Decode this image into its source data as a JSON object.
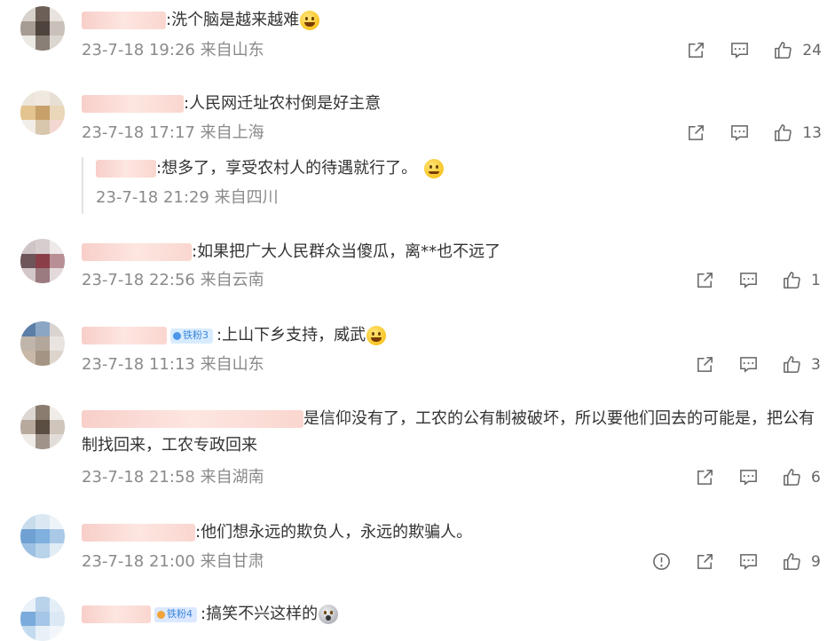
{
  "comments": [
    {
      "text": "洗个脑是越来越难",
      "time": "23-7-18 19:26",
      "location": "来自山东",
      "likes": "24",
      "emoji": "grin"
    },
    {
      "text": "人民网迁址农村倒是好主意",
      "time": "23-7-18 17:17",
      "location": "来自上海",
      "likes": "13",
      "reply": {
        "text": "想多了，享受农村人的待遇就行了。",
        "time": "23-7-18 21:29",
        "location": "来自四川",
        "emoji": "smile"
      }
    },
    {
      "text": "如果把广大人民群众当傻瓜，离**也不远了",
      "time": "23-7-18 22:56",
      "location": "来自云南",
      "likes": "1"
    },
    {
      "text": "上山下乡支持，威武",
      "time": "23-7-18 11:13",
      "location": "来自山东",
      "likes": "3",
      "badge": "铁粉3",
      "emoji": "cheer"
    },
    {
      "text": "是信仰没有了，工农的公有制被破坏，所以要他们回去的可能是，把公有制找回来，工农专政回来",
      "time": "23-7-18 21:58",
      "location": "来自湖南",
      "likes": "6"
    },
    {
      "text": "他们想永远的欺负人，永远的欺骗人。",
      "time": "23-7-18 21:00",
      "location": "来自甘肃",
      "likes": "9",
      "report": true
    },
    {
      "text": "搞笑不兴这样的",
      "badge": "铁粉4",
      "emoji": "shock"
    }
  ],
  "icons": {
    "share": "share-icon",
    "comment": "comment-icon",
    "like": "thumbs-up-icon",
    "report": "report-icon"
  },
  "colors": {
    "meta": "#8a8a8a",
    "text": "#333333",
    "badge_bg": "#d9ecff",
    "badge_fg": "#3b87d9"
  }
}
